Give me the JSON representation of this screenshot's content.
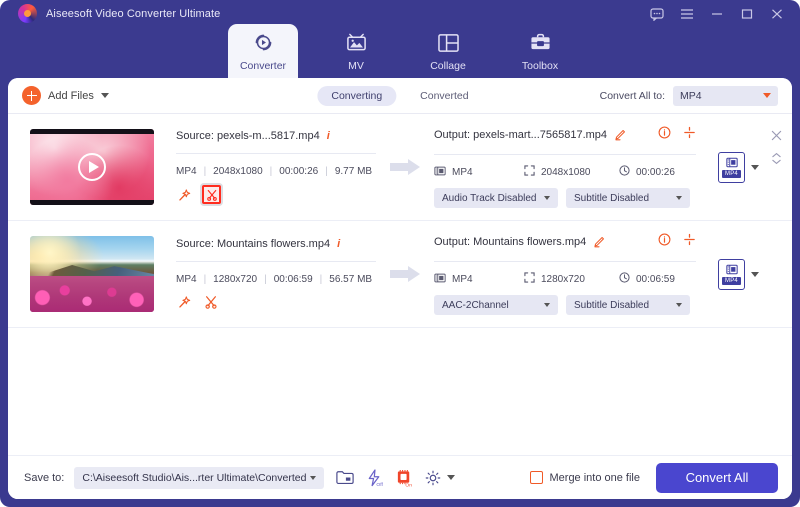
{
  "window": {
    "title": "Aiseesoft Video Converter Ultimate",
    "controls": [
      {
        "name": "feedback-icon",
        "label": "Feedback"
      },
      {
        "name": "menu-icon",
        "label": "Menu"
      },
      {
        "name": "minimize-icon",
        "label": "Minimize"
      },
      {
        "name": "maximize-icon",
        "label": "Maximize"
      },
      {
        "name": "close-icon",
        "label": "Close"
      }
    ]
  },
  "tabs": [
    {
      "label": "Converter",
      "icon": "converter-icon",
      "active": true
    },
    {
      "label": "MV",
      "icon": "mv-icon",
      "active": false
    },
    {
      "label": "Collage",
      "icon": "collage-icon",
      "active": false
    },
    {
      "label": "Toolbox",
      "icon": "toolbox-icon",
      "active": false
    }
  ],
  "toolbar": {
    "add_files_label": "Add Files",
    "segments": [
      {
        "label": "Converting",
        "active": true
      },
      {
        "label": "Converted",
        "active": false
      }
    ],
    "convert_all_to_label": "Convert All to:",
    "convert_all_to_value": "MP4"
  },
  "rows": [
    {
      "thumb": "pink-smoke",
      "source_label": "Source: pexels-m...5817.mp4",
      "source_format": "MP4",
      "source_resolution": "2048x1080",
      "source_duration": "00:00:26",
      "source_size": "9.77 MB",
      "source_tools": [
        {
          "name": "magic-wand-icon",
          "highlighted": false
        },
        {
          "name": "scissors-trim-icon",
          "highlighted": true
        }
      ],
      "output_label": "Output: pexels-mart...7565817.mp4",
      "output_format": "MP4",
      "output_resolution": "2048x1080",
      "output_duration": "00:00:26",
      "audio_track": "Audio Track Disabled",
      "subtitle": "Subtitle Disabled",
      "format_badge": "MP4"
    },
    {
      "thumb": "mountain-flowers",
      "source_label": "Source: Mountains flowers.mp4",
      "source_format": "MP4",
      "source_resolution": "1280x720",
      "source_duration": "00:06:59",
      "source_size": "56.57 MB",
      "source_tools": [
        {
          "name": "magic-wand-icon",
          "highlighted": false
        },
        {
          "name": "scissors-trim-icon",
          "highlighted": false
        }
      ],
      "output_label": "Output: Mountains flowers.mp4",
      "output_format": "MP4",
      "output_resolution": "1280x720",
      "output_duration": "00:06:59",
      "audio_track": "AAC-2Channel",
      "subtitle": "Subtitle Disabled",
      "format_badge": "MP4"
    }
  ],
  "bottom": {
    "save_to_label": "Save to:",
    "save_to_path": "C:\\Aiseesoft Studio\\Ais...rter Ultimate\\Converted",
    "icons": [
      {
        "name": "open-folder-icon",
        "state": ""
      },
      {
        "name": "hardware-acceleration-icon",
        "state": "Off"
      },
      {
        "name": "gpu-acceleration-icon",
        "state": "On"
      },
      {
        "name": "settings-gear-icon",
        "state": ""
      }
    ],
    "merge_label": "Merge into one file",
    "merge_checked": false,
    "convert_all_button": "Convert All"
  },
  "colors": {
    "window_chrome": "#3b3a8f",
    "panel_bg": "#f4f5fb",
    "accent_orange": "#f05a28",
    "accent_indigo": "#4a46cf",
    "select_bg": "#e6e7f3",
    "highlight_red": "#ff2d20"
  }
}
